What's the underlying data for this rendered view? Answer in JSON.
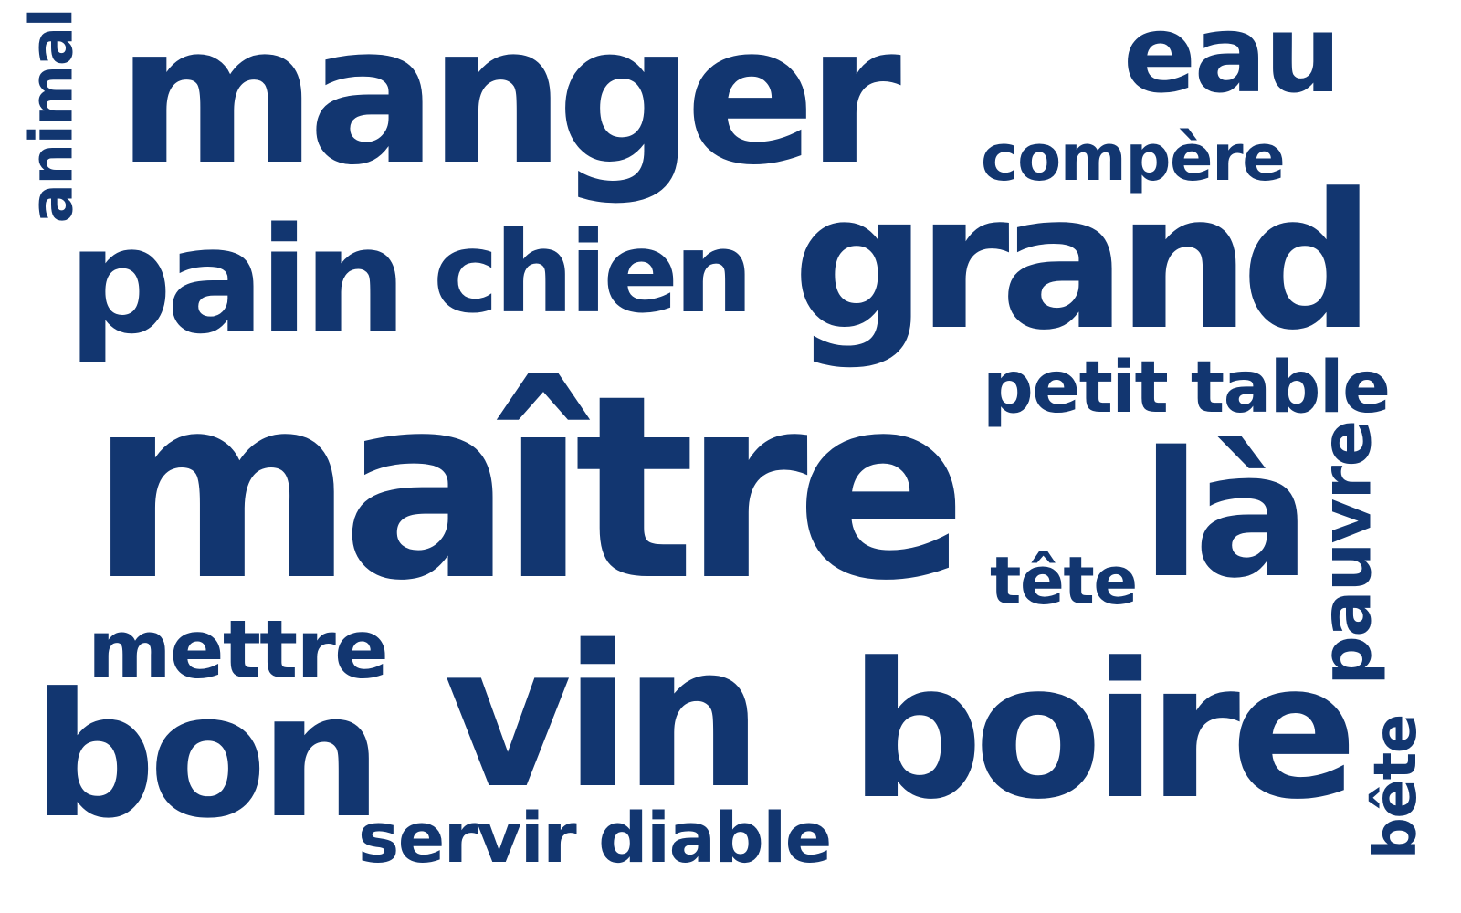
{
  "cloud": {
    "color": "#123670",
    "words": {
      "manger": "manger",
      "eau": "eau",
      "compere": "compère",
      "animal": "animal",
      "pain": "pain",
      "chien": "chien",
      "grand": "grand",
      "petit_table": "petit table",
      "maitre": "maître",
      "la": "là",
      "tete": "tête",
      "pauvre": "pauvre",
      "mettre": "mettre",
      "vin": "vin",
      "bon": "bon",
      "boire": "boire",
      "servir_diable": "servir diable",
      "bete": "bête"
    }
  }
}
